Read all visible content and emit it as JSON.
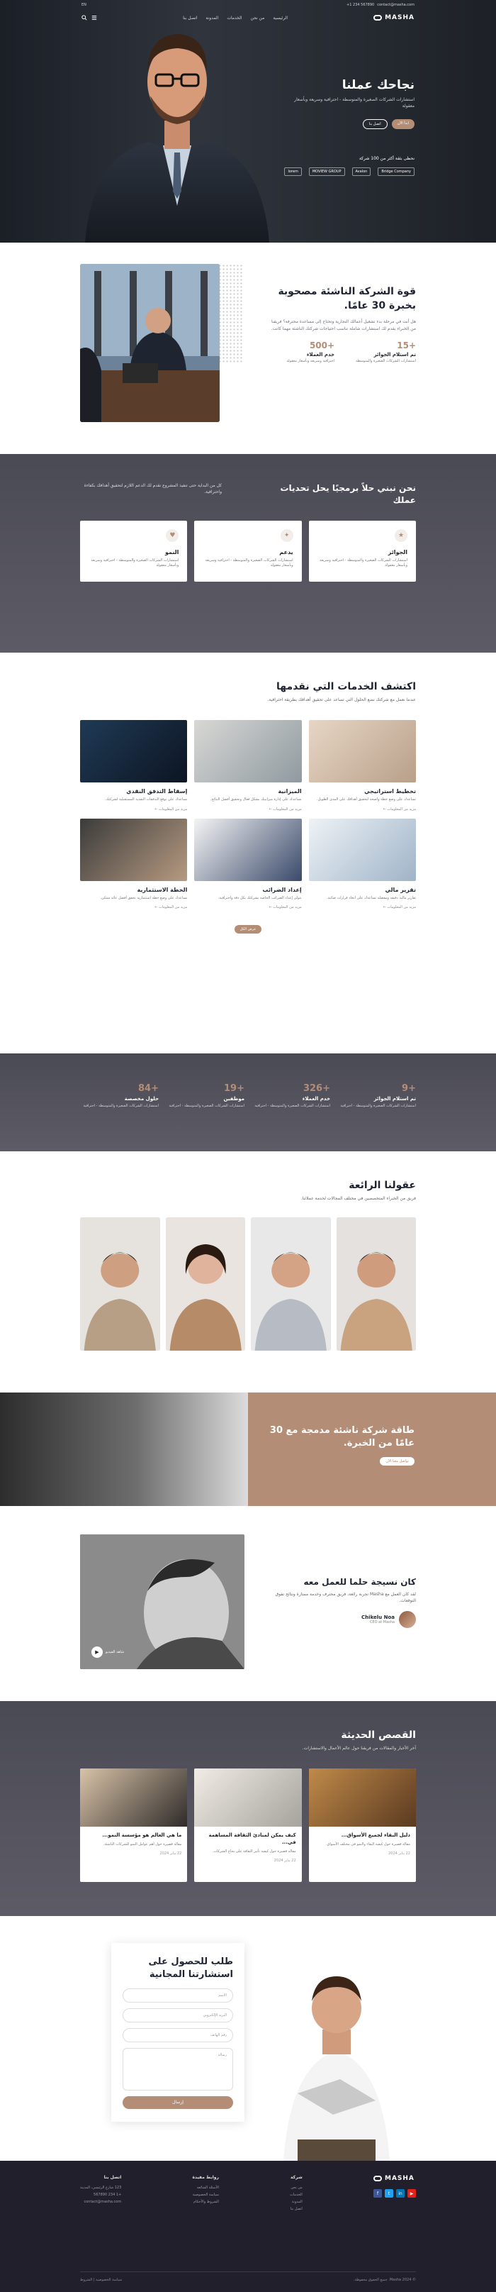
{
  "topbar": {
    "phone": "+1 234 567890",
    "email": "contact@masha.com",
    "lang": "EN"
  },
  "nav": {
    "logo": "MASHA",
    "items": [
      "الرئيسية",
      "من نحن",
      "الخدمات",
      "المدونة",
      "اتصل بنا"
    ]
  },
  "hero": {
    "title": "نجاحك عملنا",
    "text": "استشارات الشركات الصغيرة والمتوسطة - احترافية وسريعة وبأسعار معقولة",
    "primary_btn": "ابدأ الآن",
    "secondary_btn": "اتصل بنا",
    "trusted": "نحظى بثقة أكثر من 100 شركة",
    "partners": [
      "lorem",
      "MOVIEW GROUP",
      "Avalon",
      "Bridge Company"
    ]
  },
  "about": {
    "title": "قوة الشركة الناشئة مصحوبة بخبرة 30 عامًا.",
    "text": "هل أنت في مرحلة بدء تشغيل أعمالك التجارية وتحتاج إلى مساعدة محترفة؟ فريقنا من الخبراء يقدم لك استشارات شاملة تناسب احتياجات شركتك الناشئة مهما كانت.",
    "stats": [
      {
        "num": "+15",
        "label": "تم استلام الجوائز",
        "sub": "استشارات الشركات الصغيرة والمتوسطة"
      },
      {
        "num": "+500",
        "label": "خدم العملاء",
        "sub": "احترافية وسريعة وبأسعار معقولة"
      }
    ]
  },
  "features": {
    "title": "نحن نبني حلاً برمجيًا يحل تحديات عملك",
    "text": "كل من البداية حتى تنفيذ المشروع نقدم لك الدعم اللازم لتحقيق أهدافك بكفاءة واحترافية.",
    "cards": [
      {
        "icon": "award-icon",
        "title": "الجوائز",
        "text": "استشارات الشركات الصغيرة والمتوسطة - احترافية وسريعة وبأسعار معقولة"
      },
      {
        "icon": "support-icon",
        "title": "يدعم",
        "text": "استشارات الشركات الصغيرة والمتوسطة - احترافية وسريعة وبأسعار معقولة"
      },
      {
        "icon": "heart-icon",
        "title": "النمو",
        "text": "استشارات الشركات الصغيرة والمتوسطة - احترافية وسريعة وبأسعار معقولة"
      }
    ]
  },
  "services": {
    "title": "اكتشف الخدمات التي نقدمها",
    "lead": "عندما نعمل مع شركتك نضع الحلول التي تساعد على تحقيق أهدافك بطريقة احترافية.",
    "items": [
      {
        "title": "تخطيط استراتيجي",
        "text": "نساعدك على وضع خطة واضحة لتحقيق أهدافك على المدى الطويل.",
        "more": "مزيد من المعلومات ←"
      },
      {
        "title": "الميزانية",
        "text": "نساعدك على إدارة ميزانيتك بشكل فعال وتحقيق أفضل النتائج.",
        "more": "مزيد من المعلومات ←"
      },
      {
        "title": "إسقاط التدفق النقدي",
        "text": "نساعدك على توقع التدفقات النقدية المستقبلية لشركتك.",
        "more": "مزيد من المعلومات ←"
      },
      {
        "title": "تقرير مالي",
        "text": "تقارير مالية دقيقة ومفصلة تساعدك على اتخاذ قرارات صائبة.",
        "more": "مزيد من المعلومات ←"
      },
      {
        "title": "إعداد الضرائب",
        "text": "نتولى إعداد الضرائب الخاصة بشركتك بكل دقة واحترافية.",
        "more": "مزيد من المعلومات ←"
      },
      {
        "title": "الخطة الاستثمارية",
        "text": "نساعدك على وضع خطة استثمارية تحقق أفضل عائد ممكن.",
        "more": "مزيد من المعلومات ←"
      }
    ],
    "all_btn": "عرض الكل"
  },
  "counters": [
    {
      "num": "+9",
      "label": "تم استلام الجوائز",
      "sub": "استشارات الشركات الصغيرة والمتوسطة - احترافية"
    },
    {
      "num": "+326",
      "label": "خدم العملاء",
      "sub": "استشارات الشركات الصغيرة والمتوسطة - احترافية"
    },
    {
      "num": "+19",
      "label": "موظفين",
      "sub": "استشارات الشركات الصغيرة والمتوسطة - احترافية"
    },
    {
      "num": "+84",
      "label": "حلول مخصصة",
      "sub": "استشارات الشركات الصغيرة والمتوسطة - احترافية"
    }
  ],
  "team": {
    "title": "عقولنا الرائعة",
    "lead": "فريق من الخبراء المتخصصين في مختلف المجالات لخدمة عملائنا.",
    "members": [
      "member-1",
      "member-2",
      "member-3",
      "member-4"
    ]
  },
  "cta": {
    "title": "طاقة شركة ناشئة مدمجة مع 30 عامًا من الخبرة.",
    "btn": "تواصل معنا الآن"
  },
  "testimonial": {
    "title": "كان نسيجة حلما للعمل معه",
    "text": "لقد كان العمل مع Masha تجربة رائعة، فريق محترف وخدمة ممتازة ونتائج تفوق التوقعات.",
    "name": "Chikelu Noa",
    "role": "CEO at Masha",
    "video_label": "شاهد الفيديو"
  },
  "blog": {
    "title": "القصص الحديثة",
    "lead": "آخر الأخبار والمقالات من فريقنا حول عالم الأعمال والاستشارات.",
    "posts": [
      {
        "title": "دليل البقاء لجميع الأسواق...",
        "text": "مقالة قصيرة حول كيفية البقاء والنمو في مختلف الأسواق.",
        "meta": "22 يناير 2024"
      },
      {
        "title": "كيف يمكن لمبادئ الثقافة المساهمة في...",
        "text": "مقالة قصيرة حول كيفية تأثير الثقافة على نجاح الشركات.",
        "meta": "22 يناير 2024"
      },
      {
        "title": "ما هي العالم هو مؤسسة النمو...",
        "text": "مقالة قصيرة حول أهم عوامل النمو للشركات الناشئة.",
        "meta": "22 يناير 2024"
      }
    ]
  },
  "contact": {
    "title": "طلب للحصول على استشارتنا المجانية",
    "fields": [
      "الاسم",
      "البريد الإلكتروني",
      "رقم الهاتف"
    ],
    "message": "رسالة",
    "submit": "إرسال"
  },
  "footer": {
    "logo": "MASHA",
    "cols": [
      {
        "title": "شركة",
        "links": [
          "من نحن",
          "الخدمات",
          "المدونة",
          "اتصل بنا"
        ]
      },
      {
        "title": "روابط مفيدة",
        "links": [
          "الأسئلة الشائعة",
          "سياسة الخصوصية",
          "الشروط والأحكام"
        ]
      },
      {
        "title": "اتصل بنا",
        "links": [
          "123 شارع الرئيسي، المدينة",
          "+1 234 567890",
          "contact@masha.com"
        ]
      }
    ],
    "copyright": "© 2024 Masha. جميع الحقوق محفوظة.",
    "bottom_links": "سياسة الخصوصية | الشروط"
  }
}
